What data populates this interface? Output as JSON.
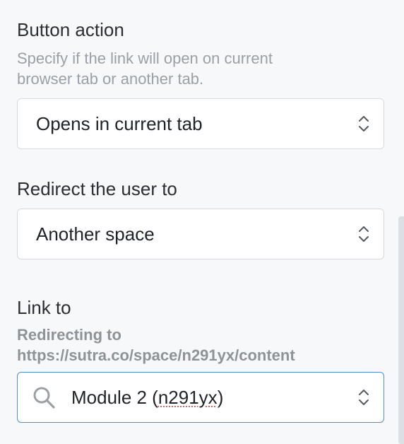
{
  "button_action": {
    "label": "Button action",
    "helper_line1": "Specify if the link will open on current",
    "helper_line2": "browser tab or another tab.",
    "select_value": "Opens in current tab"
  },
  "redirect": {
    "label": "Redirect the user to",
    "select_value": "Another space"
  },
  "link_to": {
    "label": "Link to",
    "redirect_line1": "Redirecting to",
    "redirect_line2": "https://sutra.co/space/n291yx/content",
    "select_value_prefix": "Module 2 (",
    "select_value_code": "n291yx",
    "select_value_suffix": ")"
  },
  "icons": {
    "select_chevron": "chevron-updown-icon",
    "search": "search-icon"
  },
  "colors": {
    "focus_border": "#4a90d9",
    "helper_text": "#9aa0a6"
  }
}
